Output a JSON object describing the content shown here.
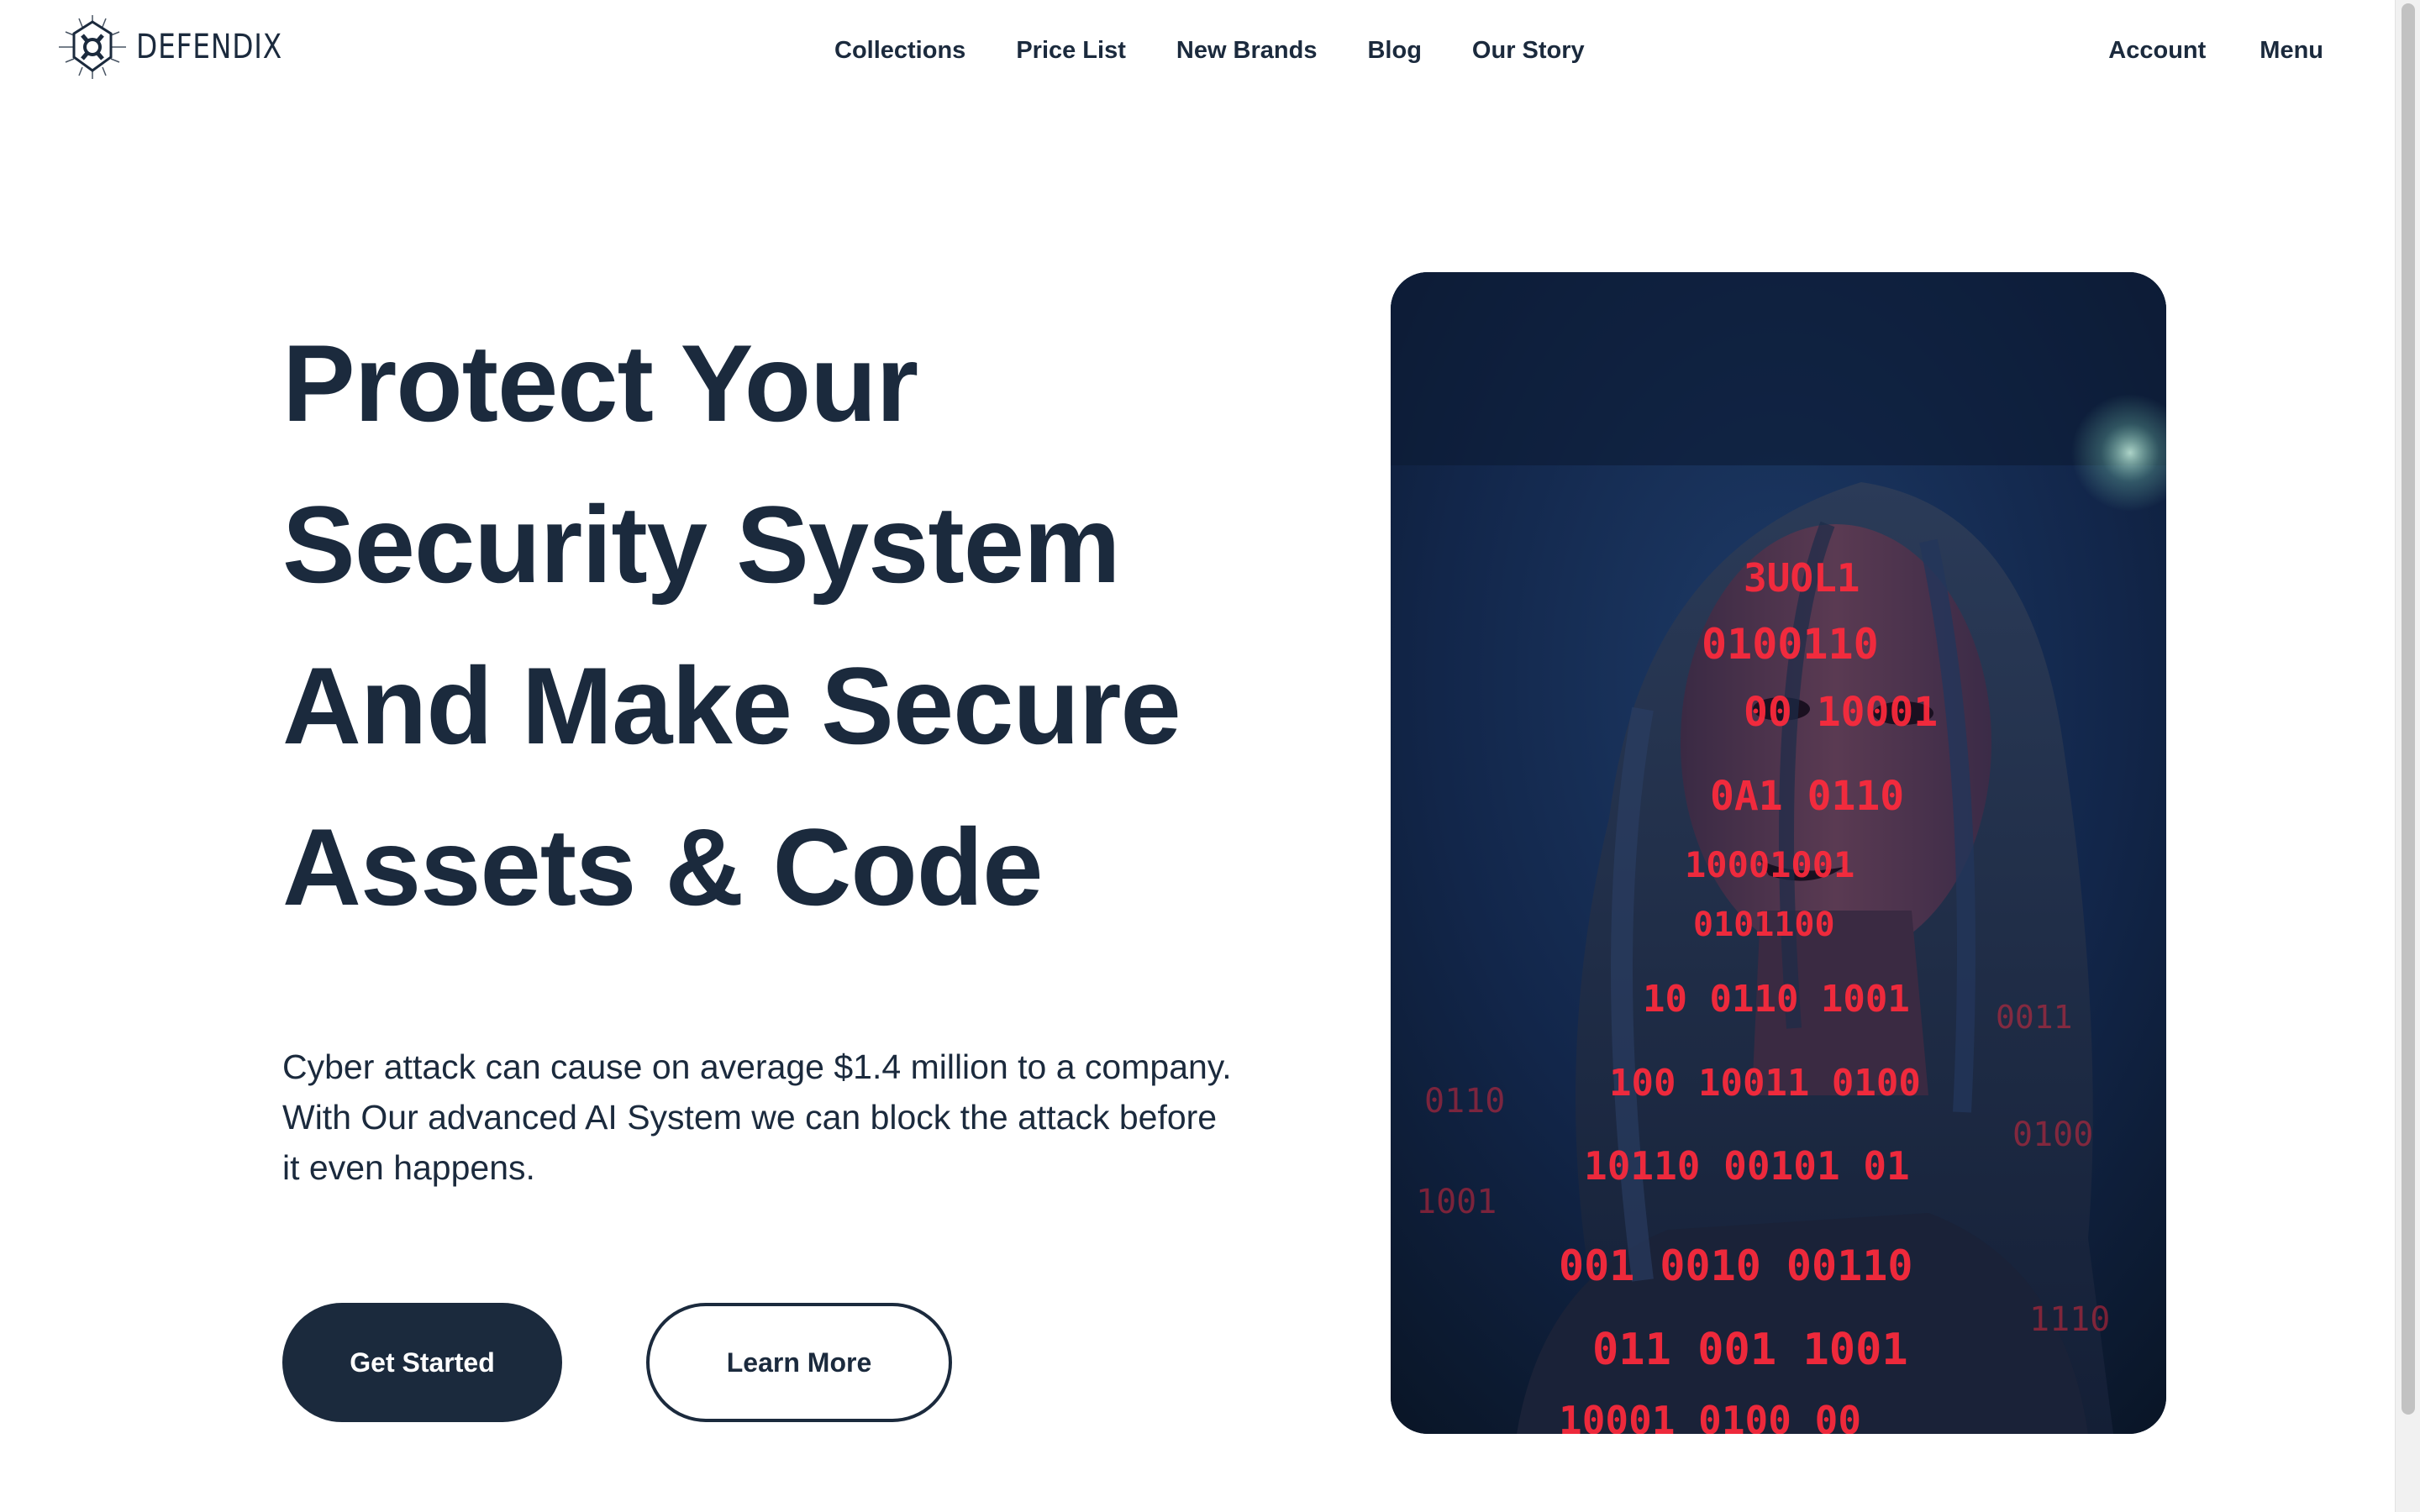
{
  "brand": {
    "name": "DEFENDIX",
    "logo_icon": "shield-crosshair-icon"
  },
  "nav": {
    "items": [
      {
        "label": "Collections"
      },
      {
        "label": "Price List"
      },
      {
        "label": "New Brands"
      },
      {
        "label": "Blog"
      },
      {
        "label": "Our Story"
      }
    ],
    "account_label": "Account",
    "menu_label": "Menu"
  },
  "hero": {
    "title_lines": [
      "Protect Your",
      "Security System",
      "And Make Secure",
      "Assets & Code"
    ],
    "description": "Cyber attack can cause on average $1.4 million to a company. With Our advanced AI System we can block the attack before it even happens.",
    "primary_button": "Get Started",
    "secondary_button": "Learn More",
    "image_subject": "woman-face-with-red-binary-code-projection"
  },
  "colors": {
    "primary": "#1b2a3d",
    "background": "#ffffff",
    "image_bg": "#0c1b33",
    "binary_red": "#ff2a3c"
  }
}
